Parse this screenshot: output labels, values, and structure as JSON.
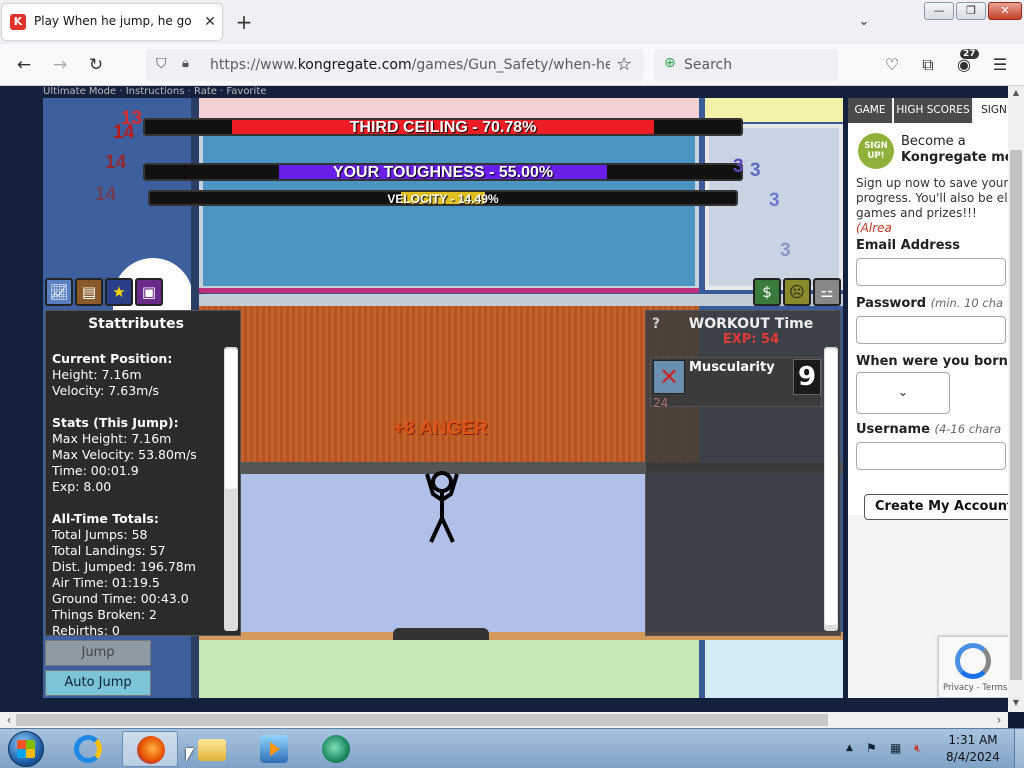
{
  "browser": {
    "tab_title": "Play When he jump, he go up h",
    "tab_favicon_letter": "K",
    "url_prefix": "https://www.",
    "url_domain": "kongregate.com",
    "url_path": "/games/Gun_Safety/when-he-jump-",
    "search_placeholder": "Search",
    "addon_badge": "27"
  },
  "game": {
    "topnav_text": "Ultimate Mode  ·  Instructions  ·  Rate  ·  Favorite",
    "hud": {
      "ceiling": {
        "label": "THIRD CEILING - 70.78%",
        "value": 70.78,
        "color": "#ee1c24"
      },
      "toughness": {
        "label": "YOUR TOUGHNESS - 55.00%",
        "value": 55.0,
        "color": "#6a1fe8"
      },
      "velocity": {
        "label": "VELOCITY - 14.49%",
        "value": 14.49,
        "color": "#e0c020"
      }
    },
    "float_numbers_left": [
      "13",
      "14",
      "14",
      "14"
    ],
    "float_numbers_right": [
      "3",
      "3",
      "3",
      "3"
    ],
    "anger_text": "+8 ANGER",
    "icons_left": [
      "chart-icon",
      "book-icon",
      "star-icon",
      "save-icon"
    ],
    "icons_right": [
      "money-icon",
      "face-icon",
      "dumbbell-icon"
    ],
    "stattributes": {
      "title": "Stattributes",
      "current_position_heading": "Current Position:",
      "height": "Height: 7.16m",
      "velocity": "Velocity: 7.63m/s",
      "this_jump_heading": "Stats (This Jump):",
      "max_height": "Max Height: 7.16m",
      "max_velocity": "Max Velocity: 53.80m/s",
      "time": "Time: 00:01.9",
      "exp": "Exp: 8.00",
      "all_time_heading": "All-Time Totals:",
      "total_jumps": "Total Jumps: 58",
      "total_landings": "Total Landings: 57",
      "dist_jumped": "Dist. Jumped: 196.78m",
      "air_time": "Air Time: 01:19.5",
      "ground_time": "Ground Time: 00:43.0",
      "things_broken": "Things Broken: 2",
      "rebirths": "Rebirths: 0"
    },
    "workout": {
      "help": "?",
      "title": "WORKOUT Time",
      "exp": "EXP: 54",
      "item_name": "Muscularity",
      "item_level": "9",
      "item_cost": "24"
    },
    "jump_label": "Jump",
    "autojump_label": "Auto Jump"
  },
  "kongregate": {
    "tabs": [
      "GAME",
      "HIGH SCORES",
      "SIGN"
    ],
    "badge_text": "SIGN UP!",
    "become": "Become a",
    "member": "Kongregate me",
    "desc_1": "Sign up now to save your progress. You'll also be eli games and prizes!!! ",
    "desc_already": "(Alrea",
    "email_label": "Email Address",
    "password_label": "Password",
    "password_hint": "(min. 10 cha",
    "born_label": "When were you born",
    "username_label": "Username",
    "username_hint": "(4-16 chara",
    "create_label": "Create My Account",
    "recaptcha_links": "Privacy - Terms"
  },
  "taskbar": {
    "time": "1:31 AM",
    "date": "8/4/2024"
  }
}
